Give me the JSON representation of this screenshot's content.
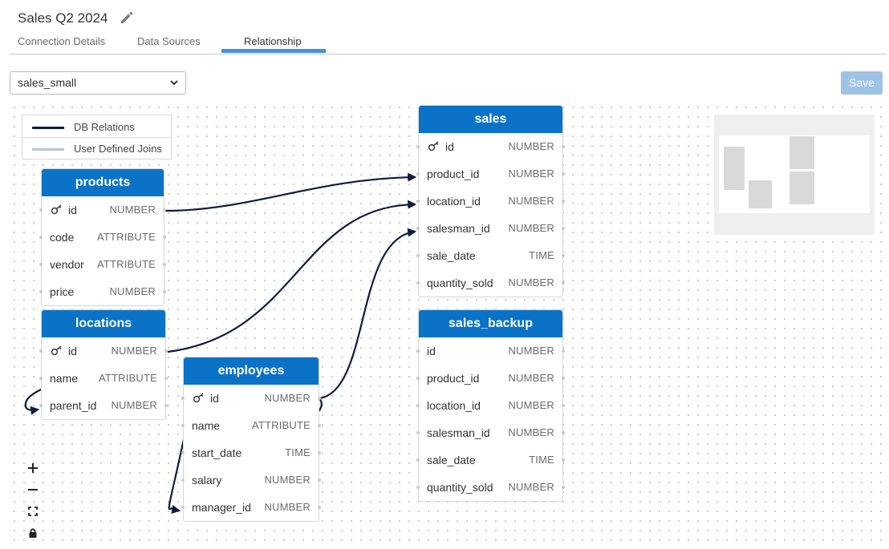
{
  "header": {
    "title": "Sales Q2 2024"
  },
  "tabs": [
    {
      "label": "Connection Details"
    },
    {
      "label": "Data Sources"
    },
    {
      "label": "Relationship"
    }
  ],
  "toolbar": {
    "dataset_selected": "sales_small",
    "save_label": "Save"
  },
  "legend": {
    "db_relations": "DB Relations",
    "user_joins": "User Defined Joins",
    "db_color": "#0d1b3d",
    "user_color": "#b9c3d6"
  },
  "colors": {
    "header_blue": "#0a73c8",
    "accent": "#4a8fd6"
  },
  "tables": {
    "products": {
      "name": "products",
      "columns": [
        {
          "name": "id",
          "type": "NUMBER",
          "pk": true
        },
        {
          "name": "code",
          "type": "ATTRIBUTE"
        },
        {
          "name": "vendor",
          "type": "ATTRIBUTE"
        },
        {
          "name": "price",
          "type": "NUMBER"
        }
      ]
    },
    "locations": {
      "name": "locations",
      "columns": [
        {
          "name": "id",
          "type": "NUMBER",
          "pk": true
        },
        {
          "name": "name",
          "type": "ATTRIBUTE"
        },
        {
          "name": "parent_id",
          "type": "NUMBER"
        }
      ]
    },
    "employees": {
      "name": "employees",
      "columns": [
        {
          "name": "id",
          "type": "NUMBER",
          "pk": true
        },
        {
          "name": "name",
          "type": "ATTRIBUTE"
        },
        {
          "name": "start_date",
          "type": "TIME"
        },
        {
          "name": "salary",
          "type": "NUMBER"
        },
        {
          "name": "manager_id",
          "type": "NUMBER"
        }
      ]
    },
    "sales": {
      "name": "sales",
      "columns": [
        {
          "name": "id",
          "type": "NUMBER",
          "pk": true
        },
        {
          "name": "product_id",
          "type": "NUMBER"
        },
        {
          "name": "location_id",
          "type": "NUMBER"
        },
        {
          "name": "salesman_id",
          "type": "NUMBER"
        },
        {
          "name": "sale_date",
          "type": "TIME"
        },
        {
          "name": "quantity_sold",
          "type": "NUMBER"
        }
      ]
    },
    "sales_backup": {
      "name": "sales_backup",
      "columns": [
        {
          "name": "id",
          "type": "NUMBER"
        },
        {
          "name": "product_id",
          "type": "NUMBER"
        },
        {
          "name": "location_id",
          "type": "NUMBER"
        },
        {
          "name": "salesman_id",
          "type": "NUMBER"
        },
        {
          "name": "sale_date",
          "type": "TIME"
        },
        {
          "name": "quantity_sold",
          "type": "NUMBER"
        }
      ]
    }
  },
  "controls": [
    {
      "icon": "zoom-in-icon"
    },
    {
      "icon": "zoom-out-icon"
    },
    {
      "icon": "fit-view-icon"
    },
    {
      "icon": "lock-icon"
    }
  ]
}
